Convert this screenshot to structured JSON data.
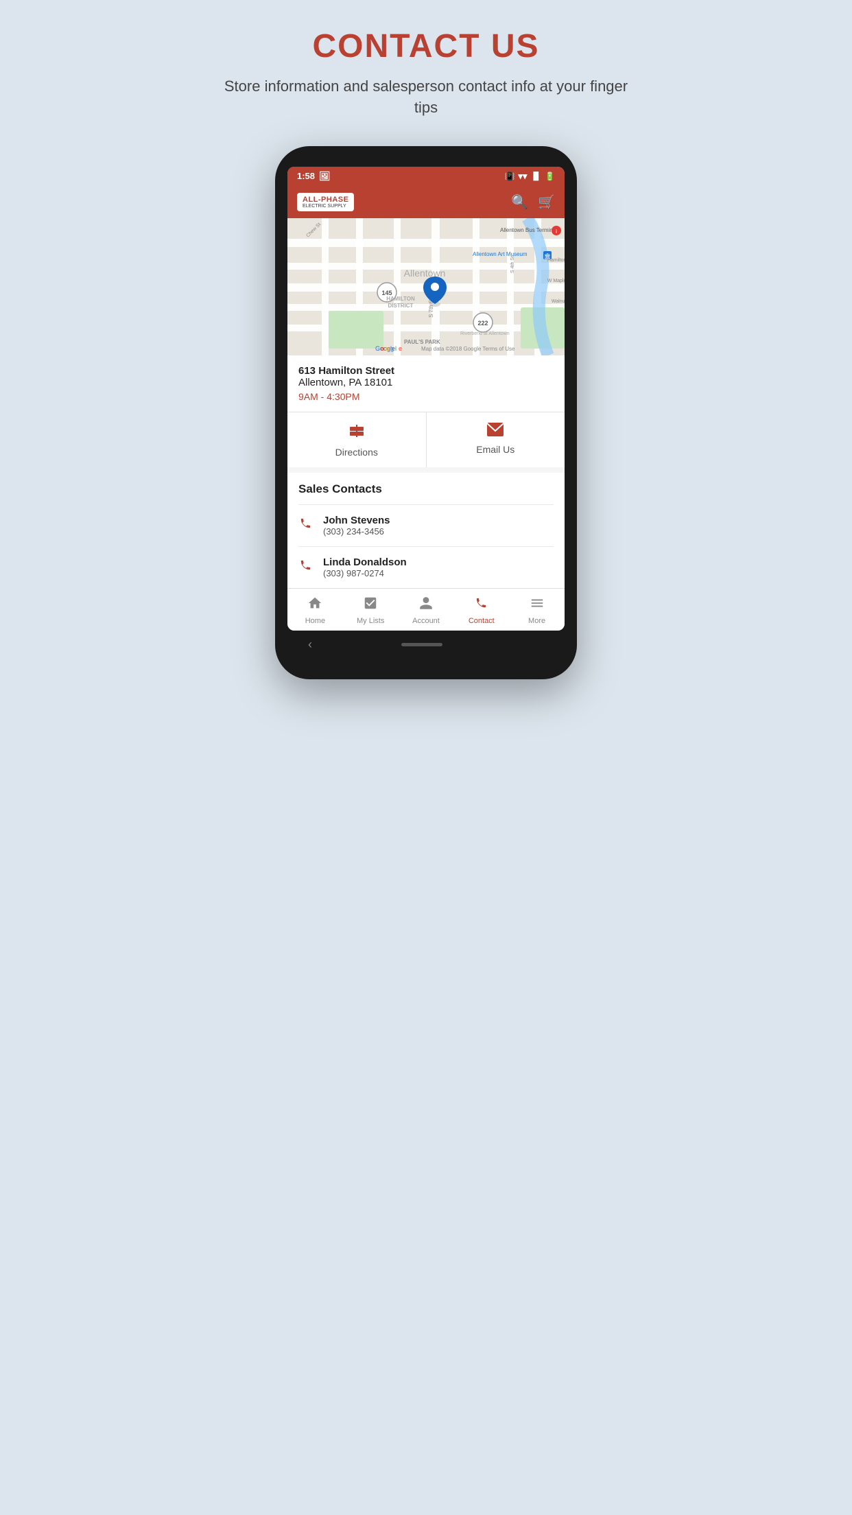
{
  "page": {
    "title": "CONTACT US",
    "subtitle": "Store information and salesperson contact info at your finger tips"
  },
  "status_bar": {
    "time": "1:58",
    "image_icon": "🖼",
    "vibrate": "📳",
    "wifi": "wifi",
    "signal": "signal",
    "battery": "battery"
  },
  "header": {
    "logo_text": "ALL-PHASE",
    "logo_sub": "ELECTRIC SUPPLY",
    "search_icon": "🔍",
    "cart_icon": "🛒"
  },
  "map": {
    "label": "Map of Allentown showing store location"
  },
  "store": {
    "address1": "613 Hamilton Street",
    "address2": "Allentown, PA 18101",
    "hours": "9AM - 4:30PM"
  },
  "actions": {
    "directions_label": "Directions",
    "email_label": "Email Us"
  },
  "sales_contacts": {
    "section_title": "Sales Contacts",
    "contacts": [
      {
        "name": "John Stevens",
        "phone": "(303) 234-3456"
      },
      {
        "name": "Linda Donaldson",
        "phone": "(303) 987-0274"
      }
    ]
  },
  "bottom_nav": {
    "items": [
      {
        "id": "home",
        "label": "Home",
        "icon": "🏠",
        "active": false
      },
      {
        "id": "my-lists",
        "label": "My Lists",
        "icon": "📋",
        "active": false
      },
      {
        "id": "account",
        "label": "Account",
        "icon": "👤",
        "active": false
      },
      {
        "id": "contact",
        "label": "Contact",
        "icon": "📞",
        "active": true
      },
      {
        "id": "more",
        "label": "More",
        "icon": "☰",
        "active": false
      }
    ]
  }
}
